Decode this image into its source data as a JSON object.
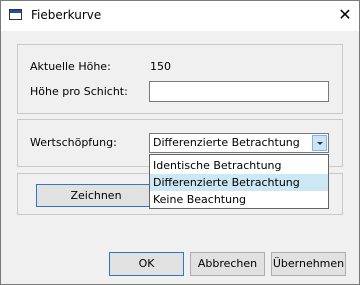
{
  "window": {
    "title": "Fieberkurve",
    "close_glyph": "✕"
  },
  "height_group": {
    "current_height_label": "Aktuelle Höhe:",
    "current_height_value": "150",
    "height_per_layer_label": "Höhe pro Schicht:",
    "height_per_layer_value": ""
  },
  "value_group": {
    "label": "Wertschöpfung:",
    "selected": "Differenzierte Betrachtung",
    "options": [
      "Identische Betrachtung",
      "Differenzierte Betrachtung",
      "Keine Beachtung"
    ]
  },
  "draw_group": {
    "draw_label": "Zeichnen"
  },
  "footer": {
    "ok_label": "OK",
    "cancel_label": "Abbrechen",
    "apply_label": "Übernehmen"
  }
}
